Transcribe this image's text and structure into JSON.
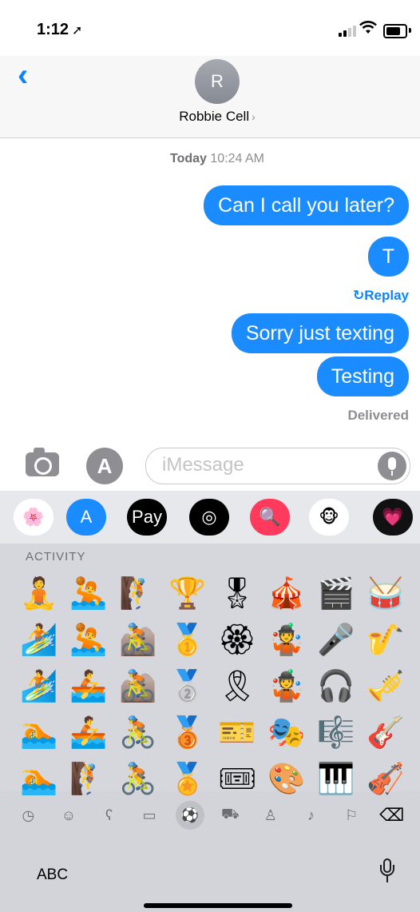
{
  "status_bar": {
    "time": "1:12",
    "location_arrow": "➚"
  },
  "header": {
    "avatar_initial": "R",
    "contact_name": "Robbie Cell",
    "chevron": "›"
  },
  "timestamp": {
    "day": "Today",
    "time": "10:24 AM"
  },
  "messages": [
    {
      "text": "Can I call you later?"
    },
    {
      "text": "T"
    },
    {
      "text": "Sorry just texting"
    },
    {
      "text": "Testing"
    }
  ],
  "replay_label": "↻Replay",
  "delivered_label": "Delivered",
  "input": {
    "placeholder": "iMessage"
  },
  "app_strip": [
    {
      "name": "photos-app-icon",
      "glyph": "🌸"
    },
    {
      "name": "app-store-icon",
      "glyph": "A"
    },
    {
      "name": "apple-pay-icon",
      "glyph": "Pay"
    },
    {
      "name": "activity-icon",
      "glyph": "◎"
    },
    {
      "name": "search-images-icon",
      "glyph": "🔍"
    },
    {
      "name": "animoji-icon",
      "glyph": "🐵"
    },
    {
      "name": "digital-touch-icon",
      "glyph": "💗"
    }
  ],
  "emoji_section": "ACTIVITY",
  "emoji": [
    "🧘",
    "🤽",
    "🧗",
    "🏆",
    "🎖",
    "🎪",
    "🎬",
    "🥁",
    "🏄",
    "🤽",
    "🚵",
    "🥇",
    "🏵",
    "🤹",
    "🎤",
    "🎷",
    "🏄",
    "🚣",
    "🚵",
    "🥈",
    "🎗",
    "🤹",
    "🎧",
    "🎺",
    "🏊",
    "🚣",
    "🚴",
    "🥉",
    "🎫",
    "🎭",
    "🎼",
    "🎸",
    "🏊",
    "🧗",
    "🚴",
    "🏅",
    "🎟",
    "🎨",
    "🎹",
    "🎻"
  ],
  "categories": [
    {
      "name": "recent-category-icon",
      "glyph": "◷"
    },
    {
      "name": "smileys-category-icon",
      "glyph": "☺"
    },
    {
      "name": "animals-category-icon",
      "glyph": "ʕ"
    },
    {
      "name": "food-category-icon",
      "glyph": "▭"
    },
    {
      "name": "activity-category-icon",
      "glyph": "⚽"
    },
    {
      "name": "travel-category-icon",
      "glyph": "⛟"
    },
    {
      "name": "objects-category-icon",
      "glyph": "♙"
    },
    {
      "name": "symbols-category-icon",
      "glyph": "♪"
    },
    {
      "name": "flags-category-icon",
      "glyph": "⚐"
    },
    {
      "name": "delete-key-icon",
      "glyph": "⌫"
    }
  ],
  "abc_key": "ABC",
  "colors": {
    "bubble": "#1a8cff",
    "link": "#0a84ff",
    "keyboard_bg": "#d5d7dc"
  }
}
